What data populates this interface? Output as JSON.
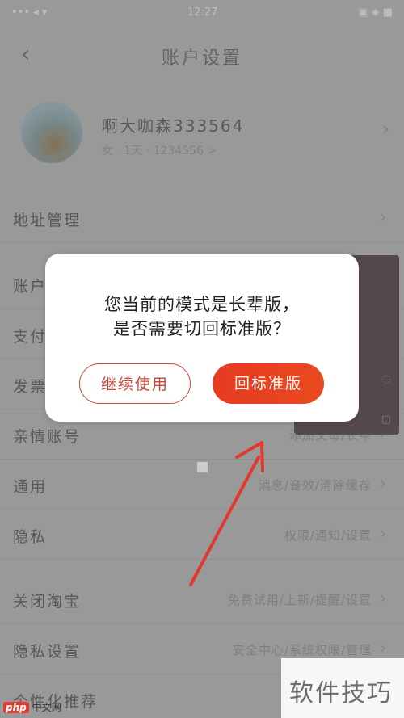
{
  "status_bar": {
    "left": "••• ◂ ▾",
    "center": "12:27",
    "right": "▣ ◈ ■"
  },
  "nav": {
    "back_icon": "‹",
    "title": "账户设置"
  },
  "profile": {
    "name": "啊大咖森333564",
    "sub": "女 · 1天 · 1234556 >",
    "chevron": "›"
  },
  "rows": [
    {
      "label": "地址管理",
      "value": ""
    },
    {
      "label": "账户",
      "value": ""
    },
    {
      "label": "支付",
      "value": ""
    },
    {
      "label": "发票",
      "value": ""
    },
    {
      "label": "亲情账号",
      "value": "添加父母/长辈"
    },
    {
      "label": "通用",
      "value": "消息/音效/清除缓存"
    },
    {
      "label": "隐私",
      "value": "权限/通知/设置"
    },
    {
      "label": "关闭淘宝",
      "value": "免费试用/上新/提醒/设置"
    },
    {
      "label": "隐私设置",
      "value": "安全中心/系统权限/管理"
    },
    {
      "label": "个性化推荐",
      "value": ""
    }
  ],
  "dialog": {
    "message_line1": "您当前的模式是长辈版，",
    "message_line2": "是否需要切回标准版？",
    "continue_button": "继续使用",
    "standard_button": "回标准版"
  },
  "watermark": {
    "text": "软件技巧",
    "logo_php": "php",
    "logo_cn": "中文网"
  },
  "colors": {
    "accent": "#e53a20",
    "button_outline": "#c9453a",
    "arrow": "#e03a2e"
  }
}
